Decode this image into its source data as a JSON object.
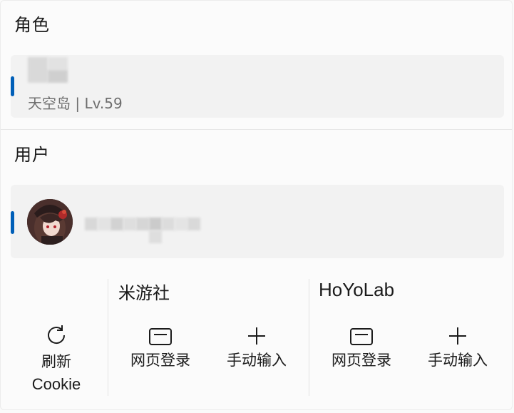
{
  "role_section": {
    "title": "角色",
    "card": {
      "subtitle": "天空岛 | Lv.59"
    }
  },
  "user_section": {
    "title": "用户"
  },
  "actions": {
    "refresh_label_line1": "刷新",
    "refresh_label_line2": "Cookie",
    "groups": [
      {
        "title": "米游社",
        "web_login_label": "网页登录",
        "manual_input_label": "手动输入"
      },
      {
        "title": "HoYoLab",
        "web_login_label": "网页登录",
        "manual_input_label": "手动输入"
      }
    ]
  },
  "colors": {
    "accent": "#005fb8",
    "card_bg": "#f2f2f2",
    "panel_bg": "#fbfbfb"
  }
}
